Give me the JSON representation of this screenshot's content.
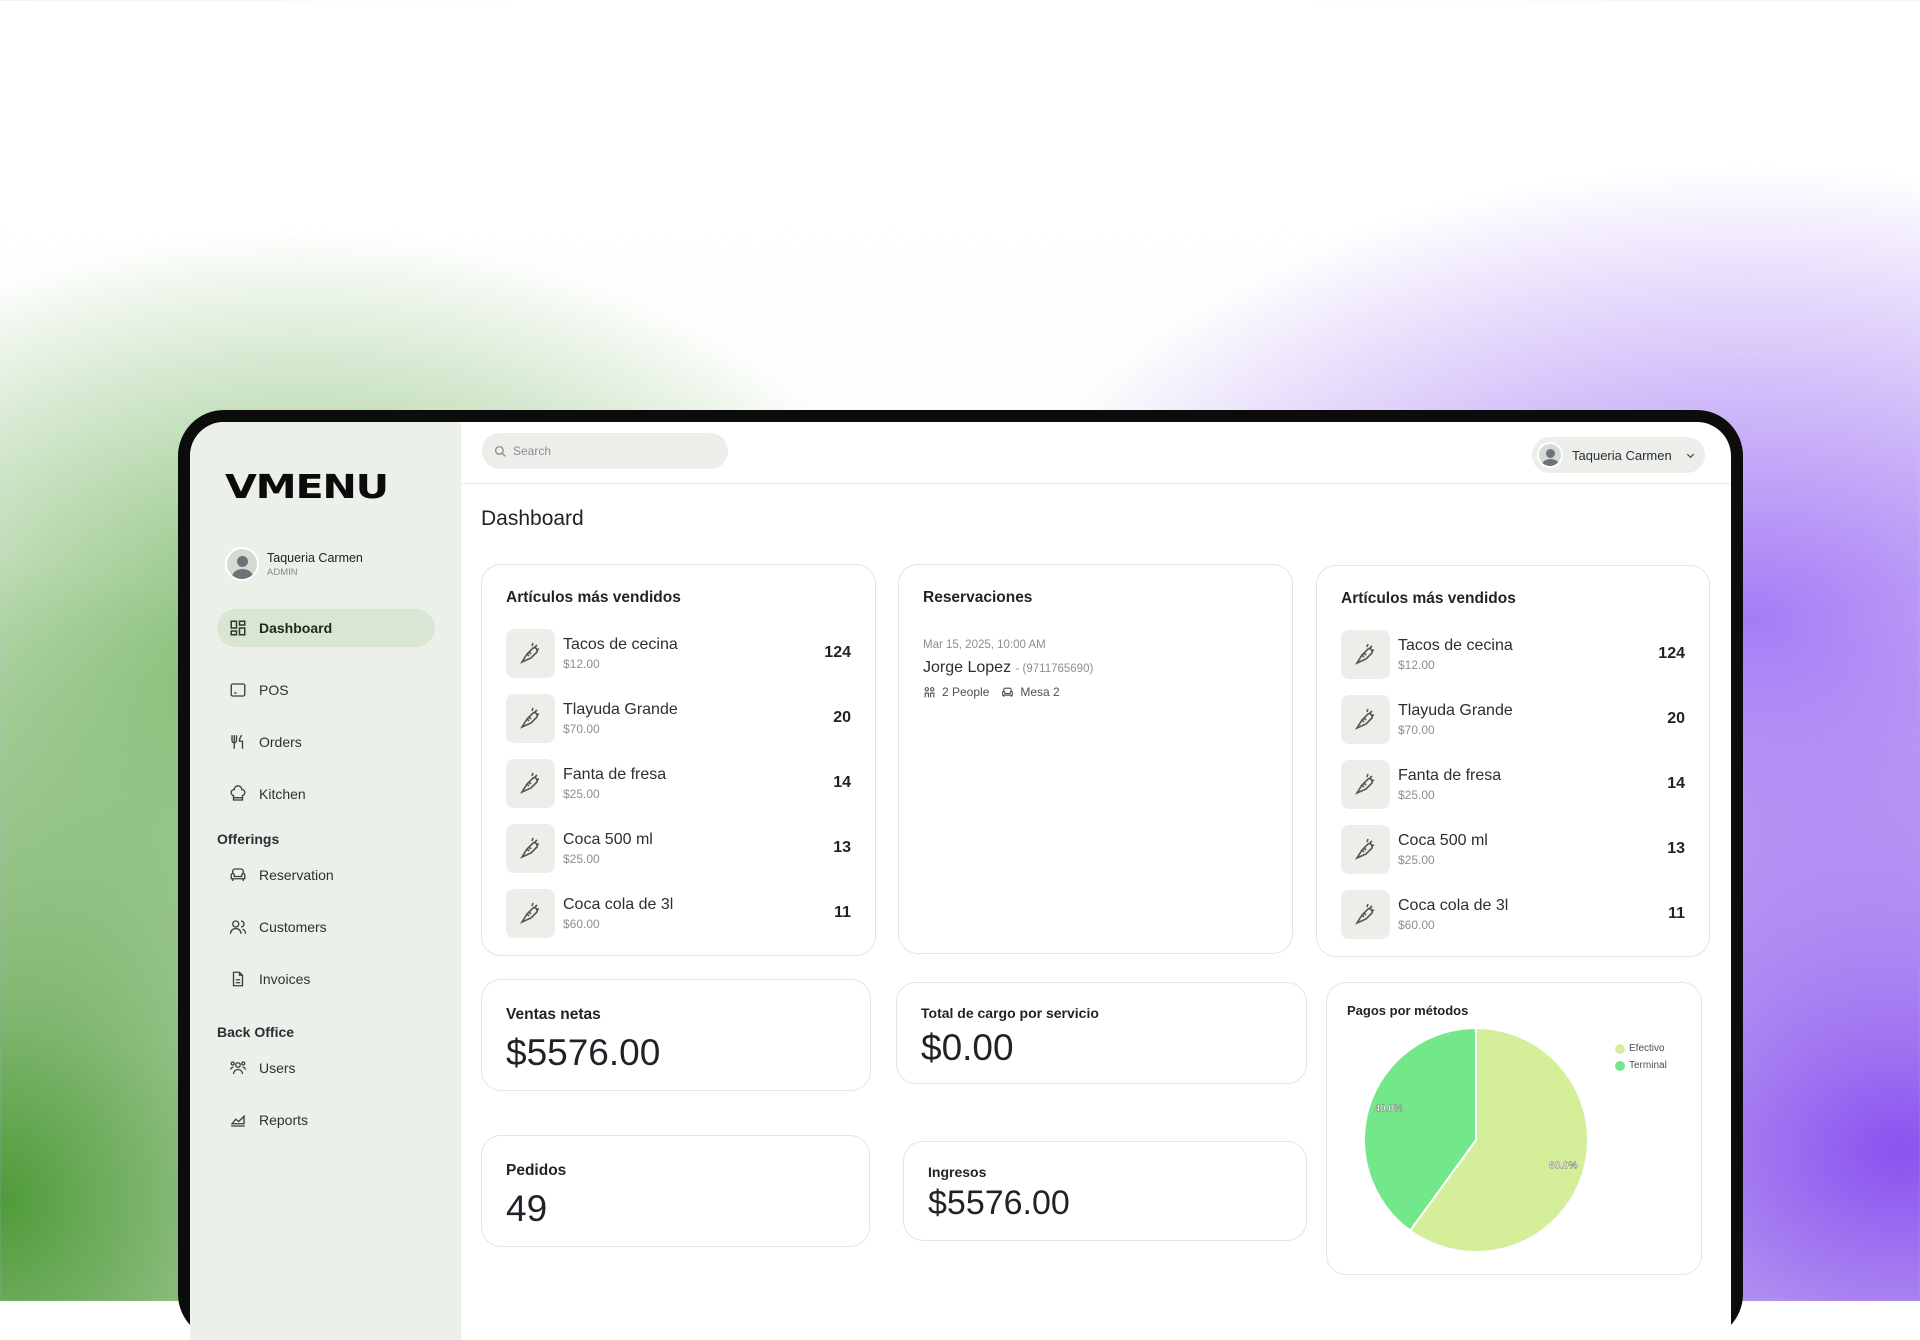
{
  "app": {
    "logo": "VMENU"
  },
  "profile": {
    "name": "Taqueria Carmen",
    "role": "ADMIN"
  },
  "sidebar": {
    "items": [
      {
        "label": "Dashboard",
        "icon": "dashboard-icon",
        "active": true
      },
      {
        "label": "POS",
        "icon": "pos-icon"
      },
      {
        "label": "Orders",
        "icon": "utensils-icon"
      },
      {
        "label": "Kitchen",
        "icon": "chef-hat-icon"
      }
    ],
    "offerings_title": "Offerings",
    "offerings": [
      {
        "label": "Reservation",
        "icon": "armchair-icon"
      },
      {
        "label": "Customers",
        "icon": "users-icon"
      },
      {
        "label": "Invoices",
        "icon": "file-icon"
      }
    ],
    "backoffice_title": "Back Office",
    "backoffice": [
      {
        "label": "Users",
        "icon": "user-group-icon"
      },
      {
        "label": "Reports",
        "icon": "chart-area-icon"
      }
    ]
  },
  "topbar": {
    "search_placeholder": "Search",
    "user_name": "Taqueria Carmen"
  },
  "page": {
    "title": "Dashboard"
  },
  "top_items_left": {
    "title": "Artículos más vendidos",
    "items": [
      {
        "name": "Tacos de cecina",
        "price": "$12.00",
        "count": "124"
      },
      {
        "name": "Tlayuda Grande",
        "price": "$70.00",
        "count": "20"
      },
      {
        "name": "Fanta de fresa",
        "price": "$25.00",
        "count": "14"
      },
      {
        "name": "Coca 500 ml",
        "price": "$25.00",
        "count": "13"
      },
      {
        "name": "Coca cola de 3l",
        "price": "$60.00",
        "count": "11"
      }
    ]
  },
  "reservations": {
    "title": "Reservaciones",
    "entries": [
      {
        "datetime": "Mar 15, 2025, 10:00 AM",
        "name": "Jorge Lopez",
        "phone": "- (9711765690)",
        "people": "2 People",
        "table": "Mesa 2"
      }
    ]
  },
  "top_items_right": {
    "title": "Artículos más vendidos",
    "items": [
      {
        "name": "Tacos de cecina",
        "price": "$12.00",
        "count": "124"
      },
      {
        "name": "Tlayuda Grande",
        "price": "$70.00",
        "count": "20"
      },
      {
        "name": "Fanta de fresa",
        "price": "$25.00",
        "count": "14"
      },
      {
        "name": "Coca 500 ml",
        "price": "$25.00",
        "count": "13"
      },
      {
        "name": "Coca cola de 3l",
        "price": "$60.00",
        "count": "11"
      }
    ]
  },
  "stats": {
    "ventas_netas": {
      "label": "Ventas netas",
      "value": "$5576.00"
    },
    "cargo_servicio": {
      "label": "Total de cargo por servicio",
      "value": "$0.00"
    },
    "pedidos": {
      "label": "Pedidos",
      "value": "49"
    },
    "ingresos": {
      "label": "Ingresos",
      "value": "$5576.00"
    }
  },
  "chart_data": {
    "type": "pie",
    "title": "Pagos por métodos",
    "slices": [
      {
        "label": "Efectivo",
        "value": 60.0,
        "display": "60.0%",
        "color": "#d4ee9a"
      },
      {
        "label": "Terminal",
        "value": 40.0,
        "display": "40.0%",
        "color": "#73e88a"
      }
    ],
    "legend_position": "top-right"
  }
}
